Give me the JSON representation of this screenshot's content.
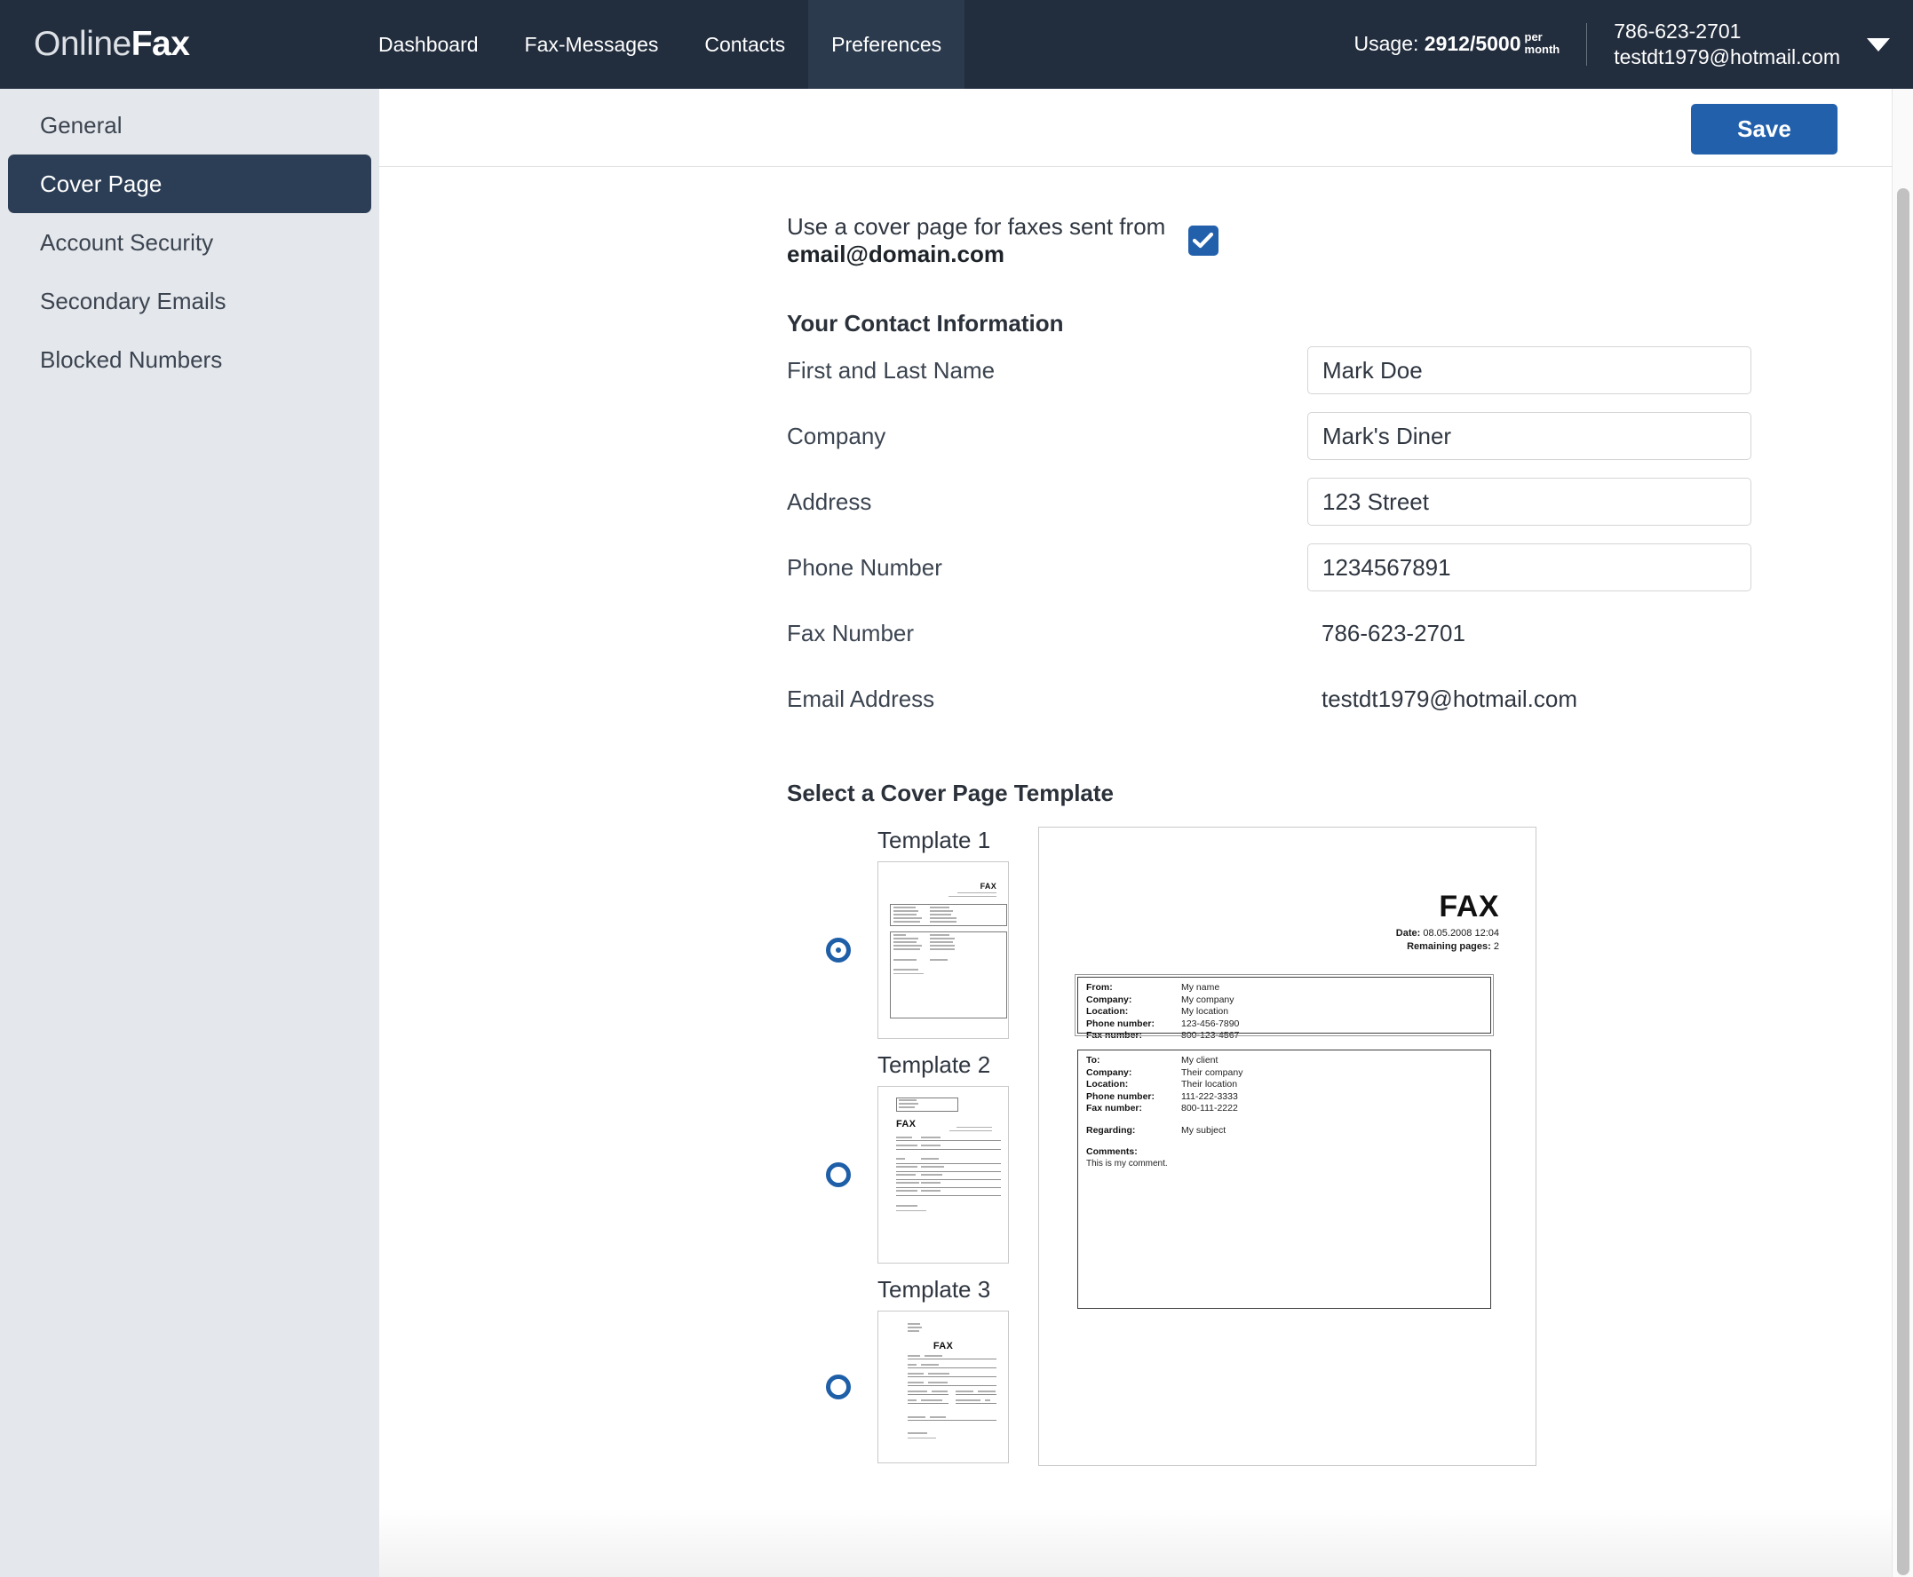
{
  "header": {
    "logo_thin": "Online",
    "logo_bold": "Fax",
    "tabs": [
      {
        "label": "Dashboard",
        "active": false
      },
      {
        "label": "Fax-Messages",
        "active": false
      },
      {
        "label": "Contacts",
        "active": false
      },
      {
        "label": "Preferences",
        "active": true
      }
    ],
    "usage_prefix": "Usage:",
    "usage_value": "2912/5000",
    "usage_per": "per",
    "usage_month": "month",
    "account_phone": "786-623-2701",
    "account_email": "testdt1979@hotmail.com",
    "caret_icon": "chevron-down-icon"
  },
  "sidebar": {
    "items": [
      {
        "label": "General",
        "active": false
      },
      {
        "label": "Cover Page",
        "active": true
      },
      {
        "label": "Account Security",
        "active": false
      },
      {
        "label": "Secondary Emails",
        "active": false
      },
      {
        "label": "Blocked Numbers",
        "active": false
      }
    ]
  },
  "toolbar": {
    "save_label": "Save"
  },
  "main": {
    "cover_toggle_text": "Use a cover page for faxes sent from ",
    "cover_toggle_email": "email@domain.com",
    "cover_toggle_checked": true,
    "contact_heading": "Your Contact Information",
    "fields": [
      {
        "label": "First and Last Name",
        "value": "Mark Doe",
        "editable": true
      },
      {
        "label": "Company",
        "value": "Mark's Diner",
        "editable": true
      },
      {
        "label": "Address",
        "value": "123 Street",
        "editable": true
      },
      {
        "label": "Phone Number",
        "value": "1234567891",
        "editable": true
      },
      {
        "label": "Fax Number",
        "value": "786-623-2701",
        "editable": false
      },
      {
        "label": "Email Address",
        "value": "testdt1979@hotmail.com",
        "editable": false
      }
    ],
    "template_heading": "Select a Cover Page Template",
    "templates": [
      {
        "label": "Template 1",
        "selected": true
      },
      {
        "label": "Template 2",
        "selected": false
      },
      {
        "label": "Template 3",
        "selected": false
      }
    ]
  },
  "preview": {
    "title": "FAX",
    "date_label": "Date:",
    "date_value": "08.05.2008 12:04",
    "pages_label": "Remaining pages:",
    "pages_value": "2",
    "from_rows": [
      {
        "key": "From:",
        "value": "My name"
      },
      {
        "key": "Company:",
        "value": "My company"
      },
      {
        "key": "Location:",
        "value": "My location"
      },
      {
        "key": "Phone number:",
        "value": "123-456-7890"
      },
      {
        "key": "Fax number:",
        "value": "800-123-4567"
      }
    ],
    "to_rows": [
      {
        "key": "To:",
        "value": "My client"
      },
      {
        "key": "Company:",
        "value": "Their company"
      },
      {
        "key": "Location:",
        "value": "Their location"
      },
      {
        "key": "Phone number:",
        "value": "111-222-3333"
      },
      {
        "key": "Fax number:",
        "value": "800-111-2222"
      }
    ],
    "regarding_label": "Regarding:",
    "regarding_value": "My subject",
    "comments_label": "Comments:",
    "comments_value": "This is my comment."
  },
  "colors": {
    "nav_bg": "#222d3d",
    "nav_active": "#2c3a4d",
    "sidebar_bg": "#e4e7eb",
    "sidebar_active": "#2c3e56",
    "accent_blue": "#2360ab",
    "radio_blue": "#1e5fa8"
  }
}
